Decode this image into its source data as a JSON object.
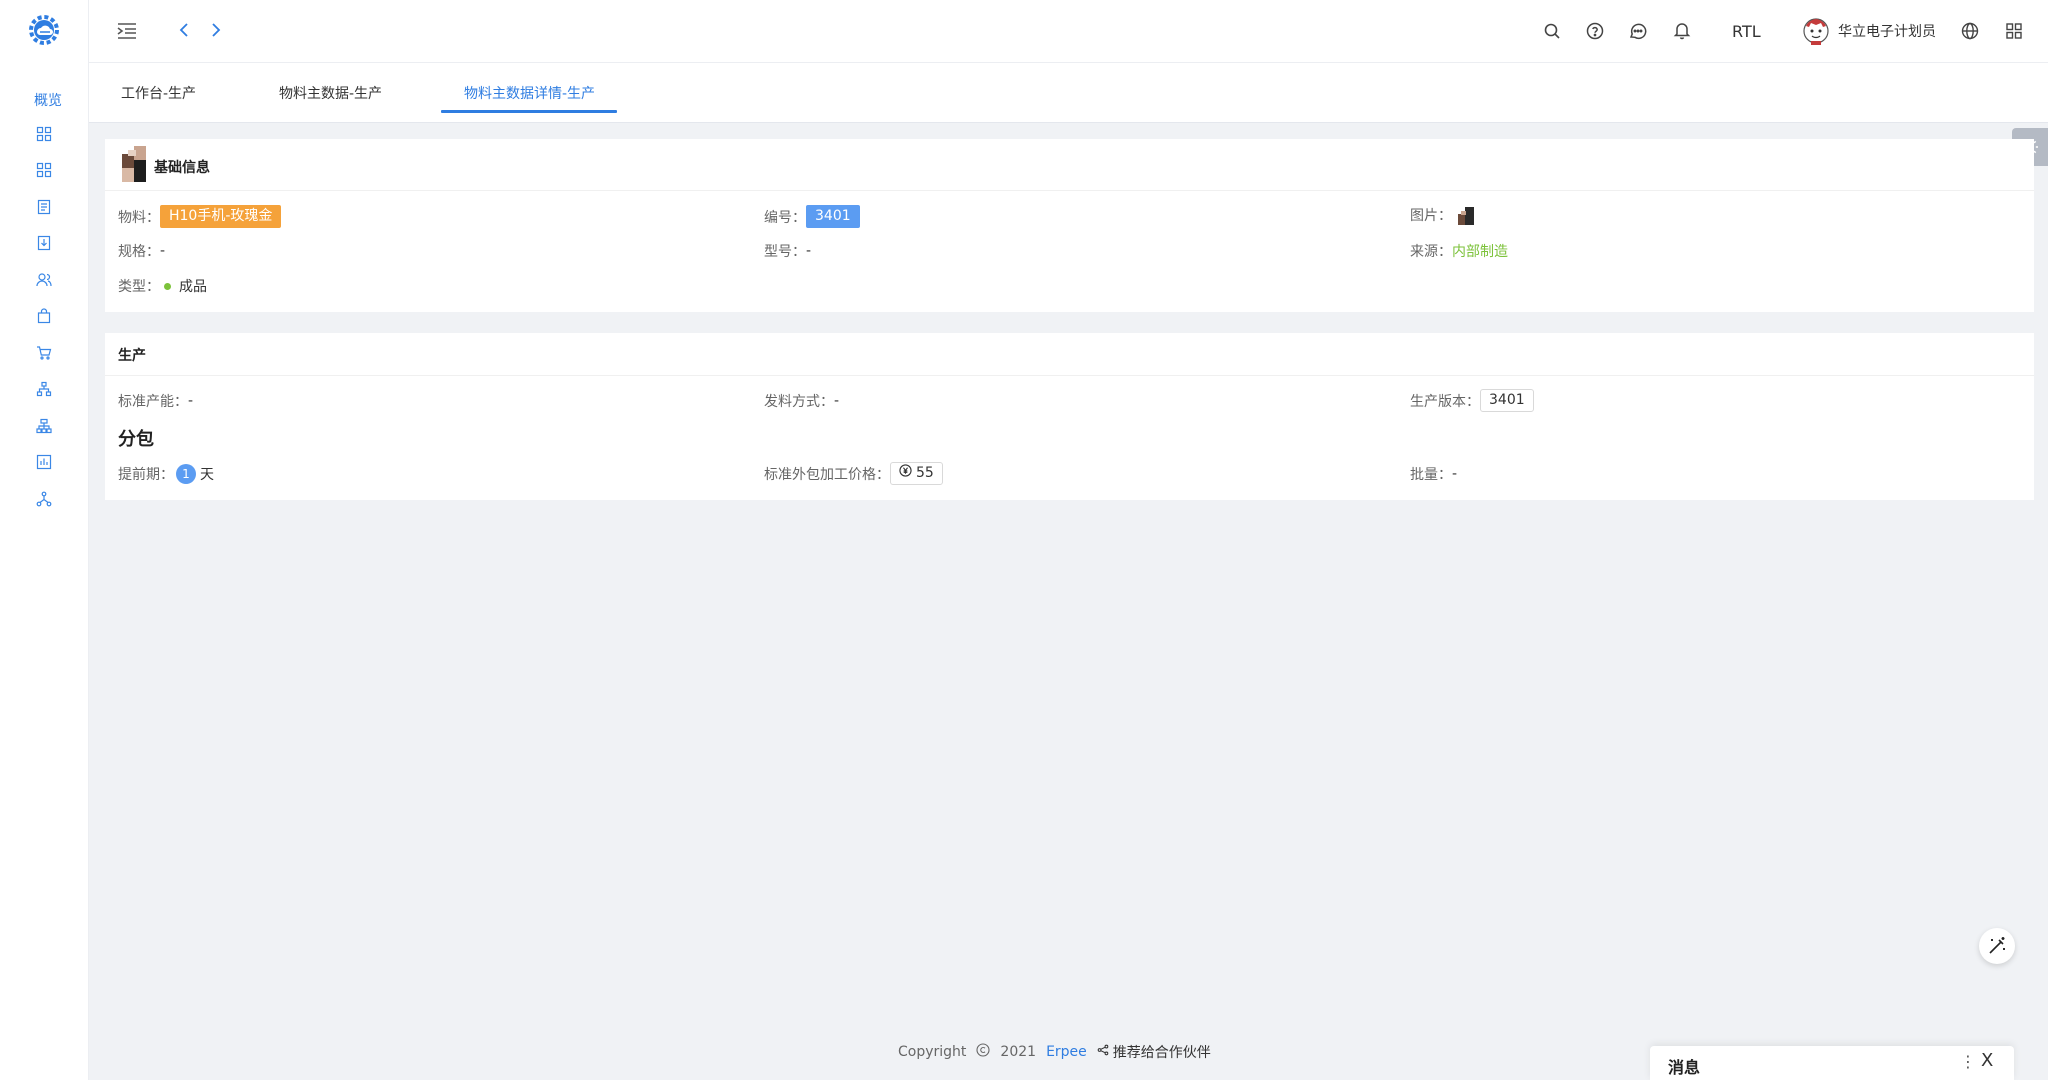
{
  "sidebar": {
    "overview_label": "概览",
    "icons": [
      "dashboard-icon",
      "grid-icon",
      "document-icon",
      "download-doc-icon",
      "users-icon",
      "bag-icon",
      "cart-icon",
      "hierarchy-icon",
      "org-chart-icon",
      "report-icon",
      "network-icon"
    ]
  },
  "header": {
    "rtl_label": "RTL",
    "user_name": "华立电子计划员"
  },
  "tabs": [
    {
      "label": "工作台-生产"
    },
    {
      "label": "物料主数据-生产"
    },
    {
      "label": "物料主数据详情-生产"
    }
  ],
  "basic": {
    "title": "基础信息",
    "material_label": "物料：",
    "material_value": "H10手机-玫瑰金",
    "code_label": "编号：",
    "code_value": "3401",
    "image_label": "图片：",
    "spec_label": "规格：",
    "spec_value": "-",
    "model_label": "型号：",
    "model_value": "-",
    "source_label": "来源：",
    "source_value": "内部制造",
    "type_label": "类型：",
    "type_value": "成品"
  },
  "production": {
    "title": "生产",
    "capacity_label": "标准产能：",
    "capacity_value": "-",
    "issue_label": "发料方式：",
    "issue_value": "-",
    "version_label": "生产版本：",
    "version_value": "3401",
    "subcontract_title": "分包",
    "lead_label": "提前期：",
    "lead_value": "1",
    "lead_unit": "天",
    "price_label": "标准外包加工价格：",
    "price_value": "55",
    "batch_label": "批量：",
    "batch_value": "-"
  },
  "footer": {
    "copyright": "Copyright",
    "year": "2021",
    "brand": "Erpee",
    "share": "推荐给合作伙伴"
  },
  "messages": {
    "title": "消息",
    "more": "⋮",
    "close": "X"
  },
  "colors": {
    "accent": "#2f7de1",
    "orange_tag": "#f5a23a",
    "blue_tag": "#5b9cf2",
    "green": "#7cc23a"
  }
}
